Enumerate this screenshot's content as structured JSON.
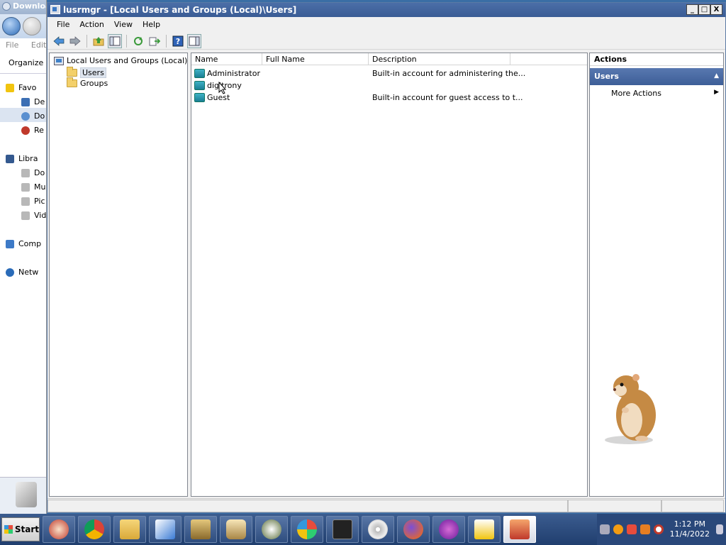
{
  "background_window": {
    "title": "Downloa",
    "menu": [
      "File",
      "Edit"
    ],
    "organize": "Organize",
    "nav": [
      {
        "label": "Favo",
        "sub": false
      },
      {
        "label": "De",
        "sub": true
      },
      {
        "label": "Do",
        "sub": true,
        "selected": true
      },
      {
        "label": "Re",
        "sub": true
      },
      {
        "label": "Libra",
        "sub": false
      },
      {
        "label": "Do",
        "sub": true
      },
      {
        "label": "Mu",
        "sub": true
      },
      {
        "label": "Pic",
        "sub": true
      },
      {
        "label": "Vid",
        "sub": true
      },
      {
        "label": "Comp",
        "sub": false
      },
      {
        "label": "Netw",
        "sub": false
      }
    ]
  },
  "window": {
    "title": "lusrmgr - [Local Users and Groups (Local)\\Users]",
    "minimize": "_",
    "maximize": "□",
    "close": "X"
  },
  "menubar": [
    "File",
    "Action",
    "View",
    "Help"
  ],
  "tree": {
    "root": "Local Users and Groups (Local)",
    "items": [
      {
        "label": "Users",
        "selected": true
      },
      {
        "label": "Groups",
        "selected": false
      }
    ]
  },
  "list": {
    "columns": [
      "Name",
      "Full Name",
      "Description"
    ],
    "rows": [
      {
        "name": "Administrator",
        "full_name": "",
        "description": "Built-in account for administering the..."
      },
      {
        "name": "digitrony",
        "full_name": "",
        "description": ""
      },
      {
        "name": "Guest",
        "full_name": "",
        "description": "Built-in account for guest access to t..."
      }
    ]
  },
  "actions": {
    "header": "Actions",
    "group": "Users",
    "items": [
      "More Actions"
    ]
  },
  "taskbar": {
    "start": "Start",
    "time": "1:12 PM",
    "date": "11/4/2022"
  }
}
